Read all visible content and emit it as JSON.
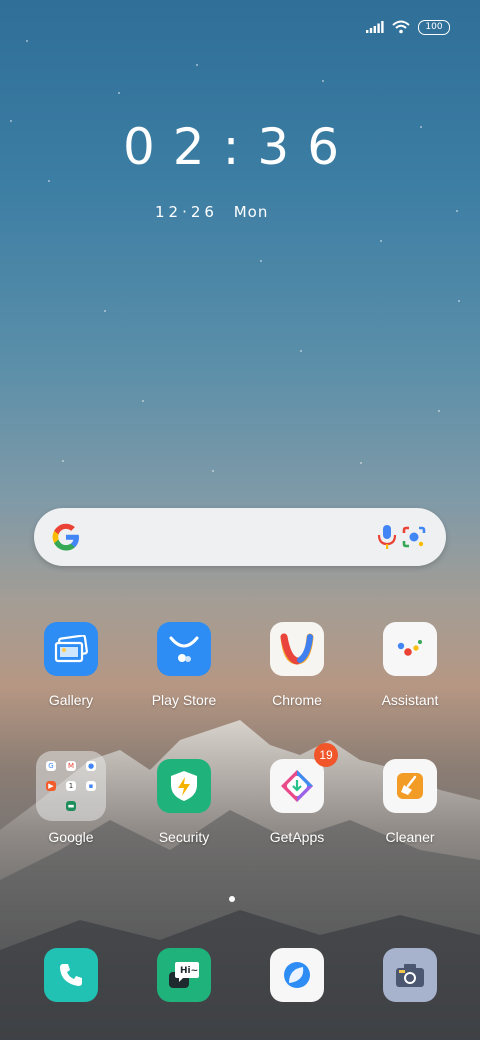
{
  "status": {
    "battery": "100"
  },
  "clock": {
    "time": "02:36",
    "date_num": "12·26",
    "weekday": "Mon"
  },
  "apps": [
    {
      "label": "Gallery"
    },
    {
      "label": "Play Store"
    },
    {
      "label": "Chrome"
    },
    {
      "label": "Assistant"
    },
    {
      "label": "Google"
    },
    {
      "label": "Security"
    },
    {
      "label": "GetApps",
      "badge": "19"
    },
    {
      "label": "Cleaner"
    }
  ],
  "dock": [
    "Phone",
    "Messaging",
    "Browser",
    "Camera"
  ],
  "colors": {
    "accent": "#3b8cf5",
    "security": "#1fb37b",
    "badge": "#f0562a"
  }
}
